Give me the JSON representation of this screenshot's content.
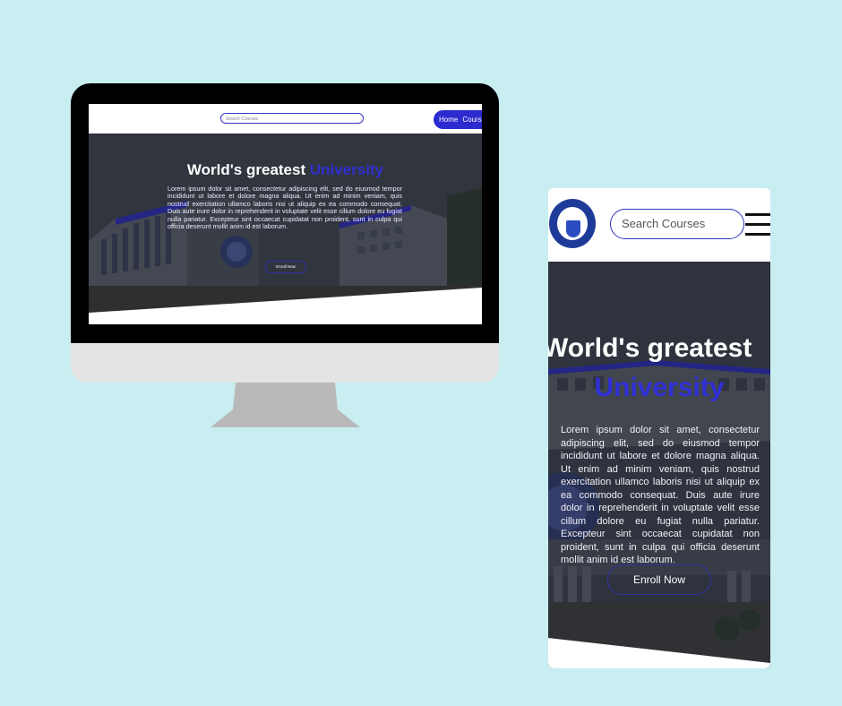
{
  "desktop": {
    "search": {
      "placeholder": "Search Courses"
    },
    "nav": {
      "home": "Home",
      "courses": "Courses"
    },
    "hero": {
      "title_main": "World's greatest ",
      "title_accent": "University",
      "body": "Lorem ipsum dolor sit amet, consectetur adipiscing elit, sed do eiusmod tempor incididunt ut labore et dolore magna aliqua. Ut enim ad minim veniam, quis nostrud exercitation ullamco laboris nisi ut aliquip ex ea commodo consequat. Duis aute irure dolor in reprehenderit in voluptate velit esse cillum dolore eu fugiat nulla pariatur. Excepteur sint occaecat cupidatat non proident, sunt in culpa qui officia deserunt mollit anim id est laborum.",
      "cta": "Enroll Now"
    }
  },
  "mobile": {
    "search": {
      "placeholder": "Search Courses"
    },
    "hero": {
      "title_main": "World's greatest",
      "title_accent": "University",
      "body": "Lorem ipsum dolor sit amet, consectetur adipiscing elit, sed do eiusmod tempor incididunt ut labore et dolore magna aliqua. Ut enim ad minim veniam, quis nostrud exercitation ullamco laboris nisi ut aliquip ex ea commodo consequat. Duis aute irure dolor in reprehenderit in voluptate velit esse cillum dolore eu fugiat nulla pariatur. Excepteur sint occaecat cupidatat non proident, sunt in culpa qui officia deserunt mollit anim id est laborum.",
      "cta": "Enroll Now"
    }
  },
  "colors": {
    "background": "#c8eef2",
    "accent": "#2f2fd0",
    "frame": "#000000"
  },
  "icons": [
    "college-seal-logo",
    "hamburger-menu-icon",
    "monitor-device",
    "phone-device"
  ]
}
